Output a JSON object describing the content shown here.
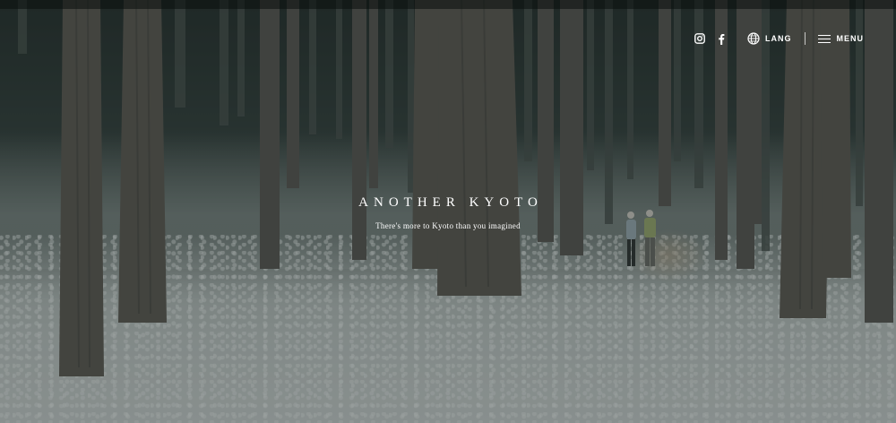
{
  "header": {
    "social": [
      {
        "icon": "instagram-icon"
      },
      {
        "icon": "facebook-icon"
      }
    ],
    "lang_label": "LANG",
    "menu_label": "MENU"
  },
  "hero": {
    "title": "ANOTHER KYOTO",
    "tagline": "There's more to Kyoto than you imagined"
  },
  "colors": {
    "text": "#ffffff",
    "overlay": "#1e2a27"
  }
}
